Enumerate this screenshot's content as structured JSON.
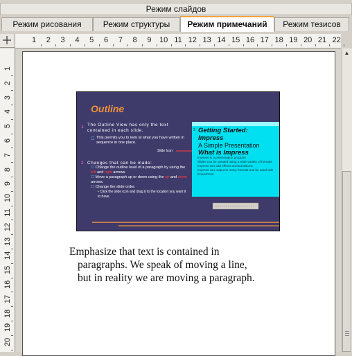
{
  "mode_bar": {
    "label": "Режим слайдов"
  },
  "tabs": [
    {
      "label": "Режим рисования"
    },
    {
      "label": "Режим структуры"
    },
    {
      "label": "Режим примечаний"
    },
    {
      "label": "Режим тезисов"
    }
  ],
  "ruler": {
    "h_numbers": [
      "1",
      "2",
      "3",
      "4",
      "5",
      "6",
      "7",
      "8",
      "9",
      "10",
      "11",
      "12",
      "13",
      "14",
      "15",
      "16",
      "17",
      "18",
      "19",
      "20",
      "21",
      "22"
    ],
    "v_numbers": [
      "1",
      "2",
      "3",
      "4",
      "5",
      "6",
      "7",
      "8",
      "9",
      "10",
      "11",
      "12",
      "13",
      "14",
      "15",
      "16",
      "17",
      "18",
      "19",
      "20"
    ]
  },
  "slide": {
    "title": "Outline",
    "item1_num": "1",
    "item1_text": "The Outline View has only the text contained in each slide.",
    "item1_sub": "This permits you to look at what you have written in sequence in one place.",
    "slide_icon_label": "Slide Icon",
    "item2_num": "2",
    "item2_text": "Changes that can be made:",
    "sub1": "Change the outline level of a paragraph by using the",
    "sub1_left": "left",
    "sub1_and": "and",
    "sub1_right": "right",
    "sub1_end": "arrows.",
    "sub2": "Move a paragraph up or down using the",
    "sub2_up": "up",
    "sub2_and": "and",
    "sub2_down": "down",
    "sub2_end": "arrows.",
    "sub3": "Change the slide order.",
    "sub3_detail": "Click the slide icon and drag it to the location you want it to have.",
    "panel": {
      "num": "2",
      "line1": "Getting Started:",
      "line2": "Impress",
      "line3": "A Simple Presentation",
      "line4": "What is Impress",
      "bullets": [
        "Impress is a presentation program",
        "Slides can be created using a wide variety of formats",
        "Impress can add effects and transitions",
        "Impress can output to many formats and be used with PowerPoint"
      ]
    },
    "colors": {
      "bg": "#3e3b6b",
      "title": "#f0903a",
      "cyan": "#00e0f0",
      "red": "#ff3b3b"
    }
  },
  "notes": {
    "line1": "Emphasize that text is contained in",
    "line2": "paragraphs. We speak of moving a line,",
    "line3": "but in reality we are moving a paragraph."
  }
}
